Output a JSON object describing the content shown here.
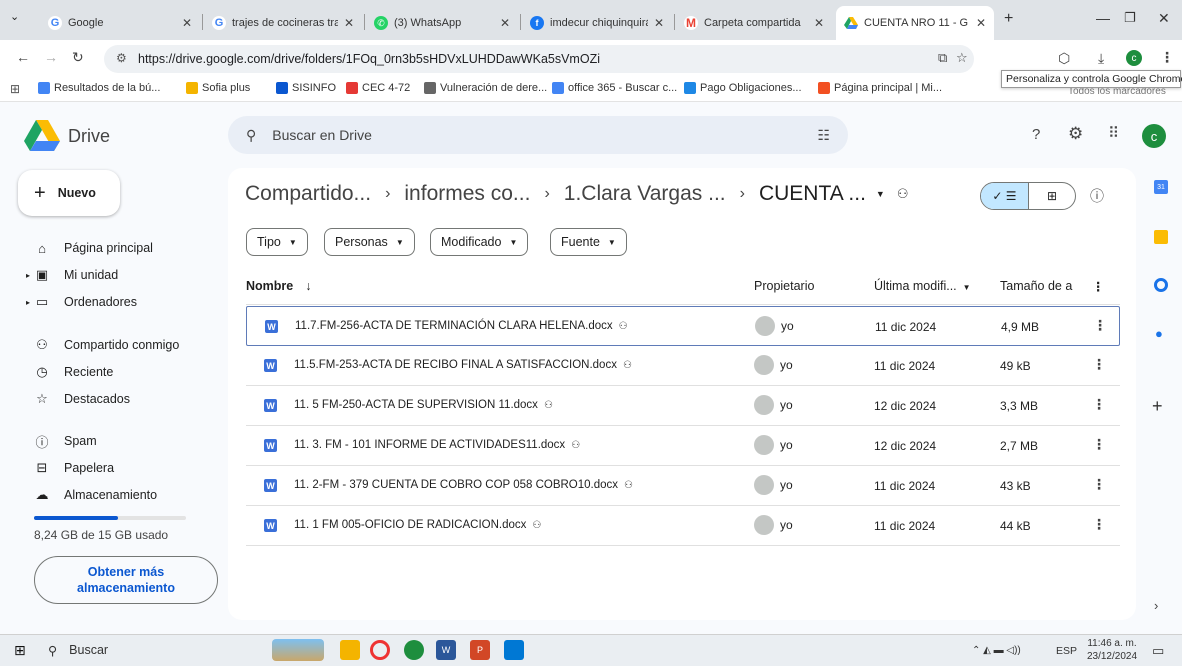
{
  "browser": {
    "tabs": [
      {
        "label": "Google",
        "icon": "google-g",
        "color": "#4285f4"
      },
      {
        "label": "trajes de cocineras tra",
        "icon": "google-g",
        "color": "#4285f4"
      },
      {
        "label": "(3) WhatsApp",
        "icon": "whatsapp",
        "color": "#25d366"
      },
      {
        "label": "imdecur chiquinquirá",
        "icon": "facebook",
        "color": "#1877f2"
      },
      {
        "label": "Carpeta compartida",
        "icon": "gmail",
        "color": "#ea4335"
      },
      {
        "label": "CUENTA NRO 11 - G",
        "icon": "drive",
        "color": "#1fa463"
      }
    ],
    "url": "https://drive.google.com/drive/folders/1FOq_0rn3b5sHDVxLUHDDawWKa5sVmOZi",
    "tooltip": "Personaliza y controla Google Chrome",
    "bookmarks": [
      {
        "label": "Resultados de la bú...",
        "color": "#4285f4"
      },
      {
        "label": "Sofia plus",
        "color": "#f4b400"
      },
      {
        "label": "SISINFO",
        "color": "#0b57d0"
      },
      {
        "label": "CEC 4-72",
        "color": "#e53935"
      },
      {
        "label": "Vulneración de dere...",
        "color": "#666666"
      },
      {
        "label": "office 365 - Buscar c...",
        "color": "#4285f4"
      },
      {
        "label": "Pago Obligaciones...",
        "color": "#1e88e5"
      },
      {
        "label": "Página principal | Mi...",
        "color": "#f25022"
      }
    ],
    "all_bookmarks": "Todos los marcadores"
  },
  "drive": {
    "logo_text": "Drive",
    "search_placeholder": "Buscar en Drive",
    "avatar_letter": "c",
    "new_button": "Nuevo",
    "nav": [
      {
        "label": "Página principal",
        "icon": "home-icon",
        "glyph": "⌂"
      },
      {
        "label": "Mi unidad",
        "icon": "my-drive-icon",
        "glyph": "▣"
      },
      {
        "label": "Ordenadores",
        "icon": "computer-icon",
        "glyph": "▭"
      },
      {
        "label": "Compartido conmigo",
        "icon": "shared-icon",
        "glyph": "⚇"
      },
      {
        "label": "Reciente",
        "icon": "clock-icon",
        "glyph": "◷"
      },
      {
        "label": "Destacados",
        "icon": "star-icon",
        "glyph": "☆"
      },
      {
        "label": "Spam",
        "icon": "spam-icon",
        "glyph": "ⓘ"
      },
      {
        "label": "Papelera",
        "icon": "trash-icon",
        "glyph": "🗑"
      },
      {
        "label": "Almacenamiento",
        "icon": "cloud-icon",
        "glyph": "☁"
      }
    ],
    "storage_text": "8,24 GB de 15 GB usado",
    "storage_fraction": 0.55,
    "get_storage_button": "Obtener más almacenamiento",
    "breadcrumb": [
      "Compartido...",
      "informes co...",
      "1.Clara Vargas ...",
      "CUENTA ..."
    ],
    "filters": [
      "Tipo",
      "Personas",
      "Modificado",
      "Fuente"
    ],
    "columns": {
      "name": "Nombre",
      "owner": "Propietario",
      "modified": "Última modifi...",
      "size": "Tamaño de a"
    },
    "files": [
      {
        "name": "11.7.FM-256-ACTA DE TERMINACIÓN CLARA HELENA.docx",
        "owner": "yo",
        "modified": "11 dic 2024",
        "size": "4,9 MB"
      },
      {
        "name": "11.5.FM-253-ACTA DE RECIBO FINAL A SATISFACCION.docx",
        "owner": "yo",
        "modified": "11 dic 2024",
        "size": "49 kB"
      },
      {
        "name": "11. 5 FM-250-ACTA DE SUPERVISION 11.docx",
        "owner": "yo",
        "modified": "12 dic 2024",
        "size": "3,3 MB"
      },
      {
        "name": "11. 3.  FM - 101 INFORME DE ACTIVIDADES11.docx",
        "owner": "yo",
        "modified": "12 dic 2024",
        "size": "2,7 MB"
      },
      {
        "name": "11. 2-FM - 379 CUENTA DE COBRO COP 058 COBRO10.docx",
        "owner": "yo",
        "modified": "11 dic 2024",
        "size": "43 kB"
      },
      {
        "name": "11. 1  FM 005-OFICIO DE RADICACION.docx",
        "owner": "yo",
        "modified": "11 dic 2024",
        "size": "44 kB"
      }
    ]
  },
  "taskbar": {
    "search": "Buscar",
    "lang": "ESP",
    "time": "11:46 a. m.",
    "date": "23/12/2024"
  }
}
